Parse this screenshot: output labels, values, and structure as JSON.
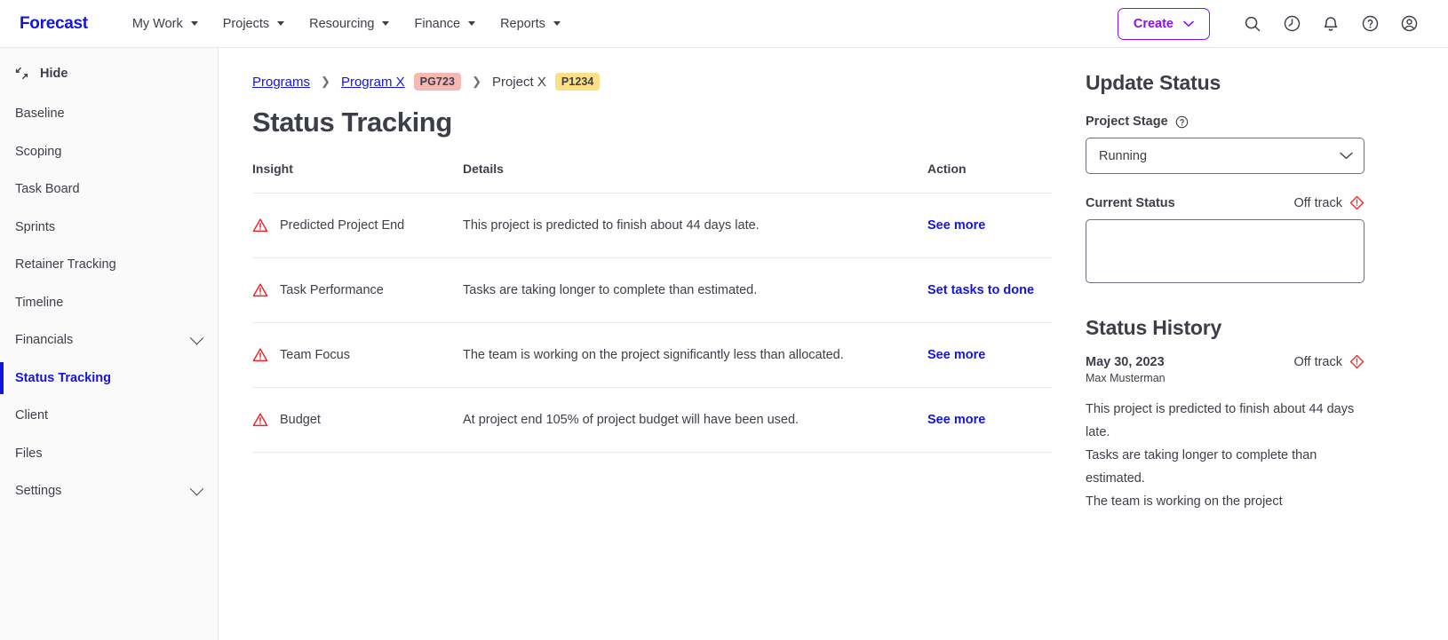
{
  "app": {
    "brand": "Forecast",
    "accent_purple": "#8612f3",
    "accent_blue": "#1414e1",
    "danger_red": "#e8262d"
  },
  "topnav": {
    "items": [
      {
        "label": "My Work",
        "icon": "chevron-down-icon"
      },
      {
        "label": "Projects",
        "icon": "chevron-down-icon"
      },
      {
        "label": "Resourcing",
        "icon": "chevron-down-icon"
      },
      {
        "label": "Finance",
        "icon": "chevron-down-icon"
      },
      {
        "label": "Reports",
        "icon": "chevron-down-icon"
      }
    ],
    "create_label": "Create",
    "icons": [
      "search-icon",
      "clock-icon",
      "bell-icon",
      "help-circle-icon",
      "user-circle-icon"
    ]
  },
  "sidebar": {
    "hide_label": "Hide",
    "items": [
      {
        "label": "Baseline",
        "active": false,
        "expandable": false
      },
      {
        "label": "Scoping",
        "active": false,
        "expandable": false
      },
      {
        "label": "Task Board",
        "active": false,
        "expandable": false
      },
      {
        "label": "Sprints",
        "active": false,
        "expandable": false
      },
      {
        "label": "Retainer Tracking",
        "active": false,
        "expandable": false
      },
      {
        "label": "Timeline",
        "active": false,
        "expandable": false
      },
      {
        "label": "Financials",
        "active": false,
        "expandable": true
      },
      {
        "label": "Status Tracking",
        "active": true,
        "expandable": false
      },
      {
        "label": "Client",
        "active": false,
        "expandable": false
      },
      {
        "label": "Files",
        "active": false,
        "expandable": false
      },
      {
        "label": "Settings",
        "active": false,
        "expandable": true
      }
    ]
  },
  "breadcrumb": {
    "programs": "Programs",
    "program": "Program X",
    "program_badge": "PG723",
    "project": "Project X",
    "project_badge": "P1234"
  },
  "page": {
    "title": "Status Tracking"
  },
  "table": {
    "headers": {
      "insight": "Insight",
      "details": "Details",
      "action": "Action"
    },
    "rows": [
      {
        "icon": "warning-triangle-icon",
        "insight": "Predicted Project End",
        "details": "This project is predicted to finish about 44 days late.",
        "action": "See more"
      },
      {
        "icon": "warning-triangle-icon",
        "insight": "Task Performance",
        "details": "Tasks are taking longer to complete than estimated.",
        "action": "Set tasks to done"
      },
      {
        "icon": "warning-triangle-icon",
        "insight": "Team Focus",
        "details": "The team is working on the project significantly less than allocated.",
        "action": "See more"
      },
      {
        "icon": "warning-triangle-icon",
        "insight": "Budget",
        "details": "At project end 105% of project budget will have been used.",
        "action": "See more"
      }
    ]
  },
  "update_status": {
    "heading": "Update Status",
    "project_stage_label": "Project Stage",
    "project_stage_help_icon": "help-circle-icon",
    "project_stage_value": "Running",
    "project_stage_options": [
      "Running"
    ],
    "current_status_label": "Current Status",
    "current_status_badge": "Off track",
    "current_status_badge_icon": "alert-diamond-icon",
    "current_status_value": "",
    "current_status_placeholder": ""
  },
  "status_history": {
    "heading": "Status History",
    "entries": [
      {
        "date": "May 30, 2023",
        "badge": "Off track",
        "badge_icon": "alert-diamond-icon",
        "author": "Max Musterman",
        "body": "This project is predicted to finish about 44 days late.\nTasks are taking longer to complete than estimated.\nThe team is working on the project"
      }
    ]
  }
}
